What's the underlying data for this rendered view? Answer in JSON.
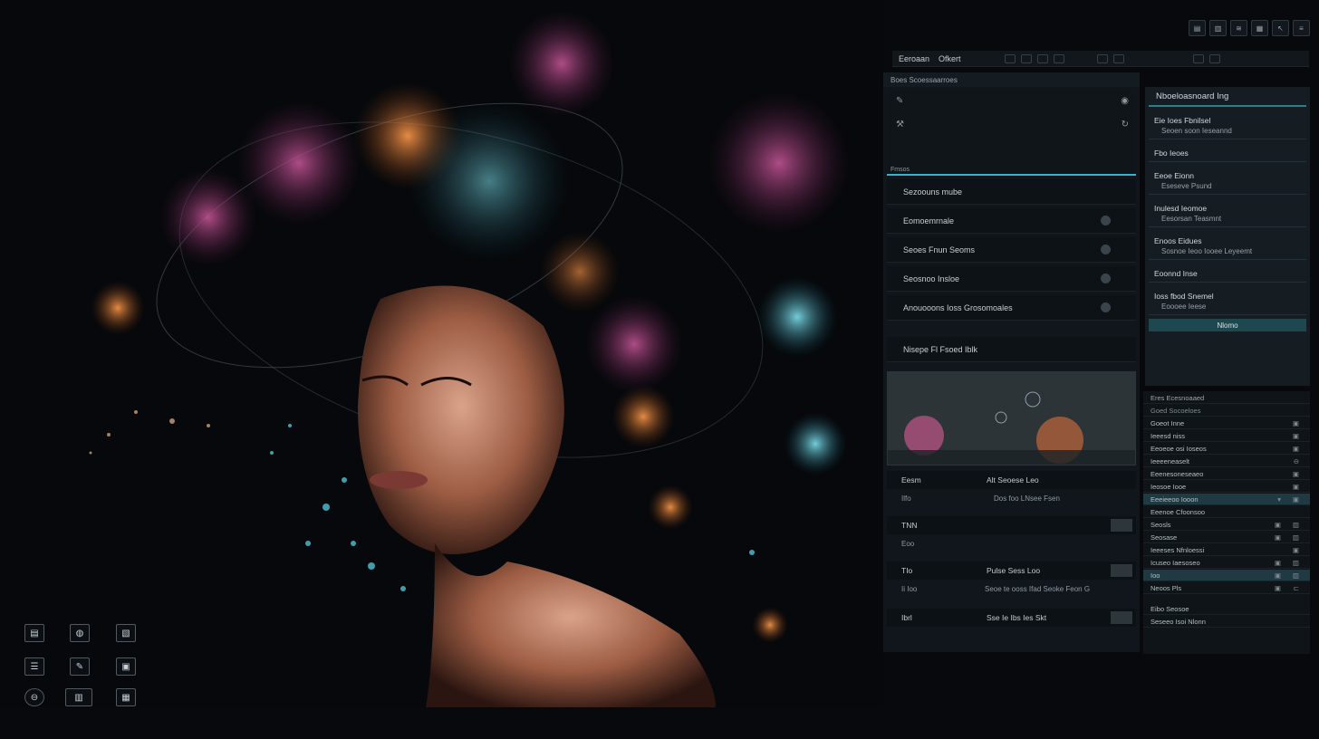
{
  "menubar": {
    "items": [
      "Eeroaan",
      "Ofkert"
    ]
  },
  "canvas_tools": [
    "brush-tool",
    "bucket-tool",
    "crop-tool",
    "grid-tool",
    "stamp-tool",
    "frame-tool",
    "eye-tool",
    "text-tool",
    "layer-tool"
  ],
  "mid_panel": {
    "header": "Boes  Scoessaarroes",
    "section_label": "Fmsos",
    "rows": [
      "Sezoouns mube",
      "Eomoemrnale",
      "Seoes Fnun Seoms",
      "Seosnoo Insloe",
      "Anouooons Ioss Grosomoales"
    ],
    "footer_row": "Nisepe Fl Fsoed Iblk",
    "bars": [
      {
        "label": "Eesm",
        "center": "Alt Seoese  Leo"
      },
      {
        "label": "Ilfo",
        "center": "Dos foo LNsee Fsen"
      },
      {
        "label": "TNN",
        "center": ""
      },
      {
        "label": "Eoo",
        "center": ""
      },
      {
        "label": "TIo",
        "center": "Pulse Sess  Loo"
      },
      {
        "label": "Ii Ioo",
        "center": "Seoe te ooss Ifad Seoke Feon  G"
      },
      {
        "label": "Ibrl",
        "center": "Sse Ie Ibs Ies Skt"
      }
    ]
  },
  "right_panel": {
    "title": "Nboeloasnoard Ing",
    "groups": [
      {
        "l1": "Eie Ioes Fbnilsel",
        "l2": "Seoen soon Ieseannd"
      },
      {
        "l1": "Fbo Ieoes",
        "l2": ""
      },
      {
        "l1": "Eeoe Eionn",
        "l2": "Eseseve Psund"
      },
      {
        "l1": "Inulesd Ieomoe",
        "l2": "Eesorsan Teasmnt"
      },
      {
        "l1": "Enoos Eidues",
        "l2": "Sosnoe Ieoo Iooee Leyeemt"
      },
      {
        "l1": "Eoonnd Inse",
        "l2": ""
      },
      {
        "l1": "Ioss fbod Snemel",
        "l2": "Eoooee Ieese"
      }
    ],
    "button": "Nlomo"
  },
  "layers": {
    "header": "Eres  Ecesnoaaed",
    "sub": "Goed Socoeloes",
    "rows": [
      "Goeot Inne",
      "Ieeesd niss",
      "Eeoeoe osi Ioseos",
      "Ieeeeneaselt",
      "Eeenesoneseaeo",
      "Ieosoe Iooe",
      "Eeeieeoo Iooon",
      "Eeenoe Cfoonsoo",
      "Seosls",
      "Seosase",
      "Ieeeses Nfnloessi",
      "Icuseo  Iaesoseo",
      "Ioo",
      "Neoos  Pls"
    ],
    "footer1": "Eibo Seosoe",
    "footer2": "Seseeo Isoi Nlonn"
  },
  "top_icons": [
    "copy-icon",
    "bookmark-icon",
    "wave-icon",
    "table-icon",
    "cursor-icon",
    "menu-icon"
  ],
  "colors": {
    "accent": "#38b4c4",
    "panel": "#141b21",
    "background": "#06080b"
  }
}
